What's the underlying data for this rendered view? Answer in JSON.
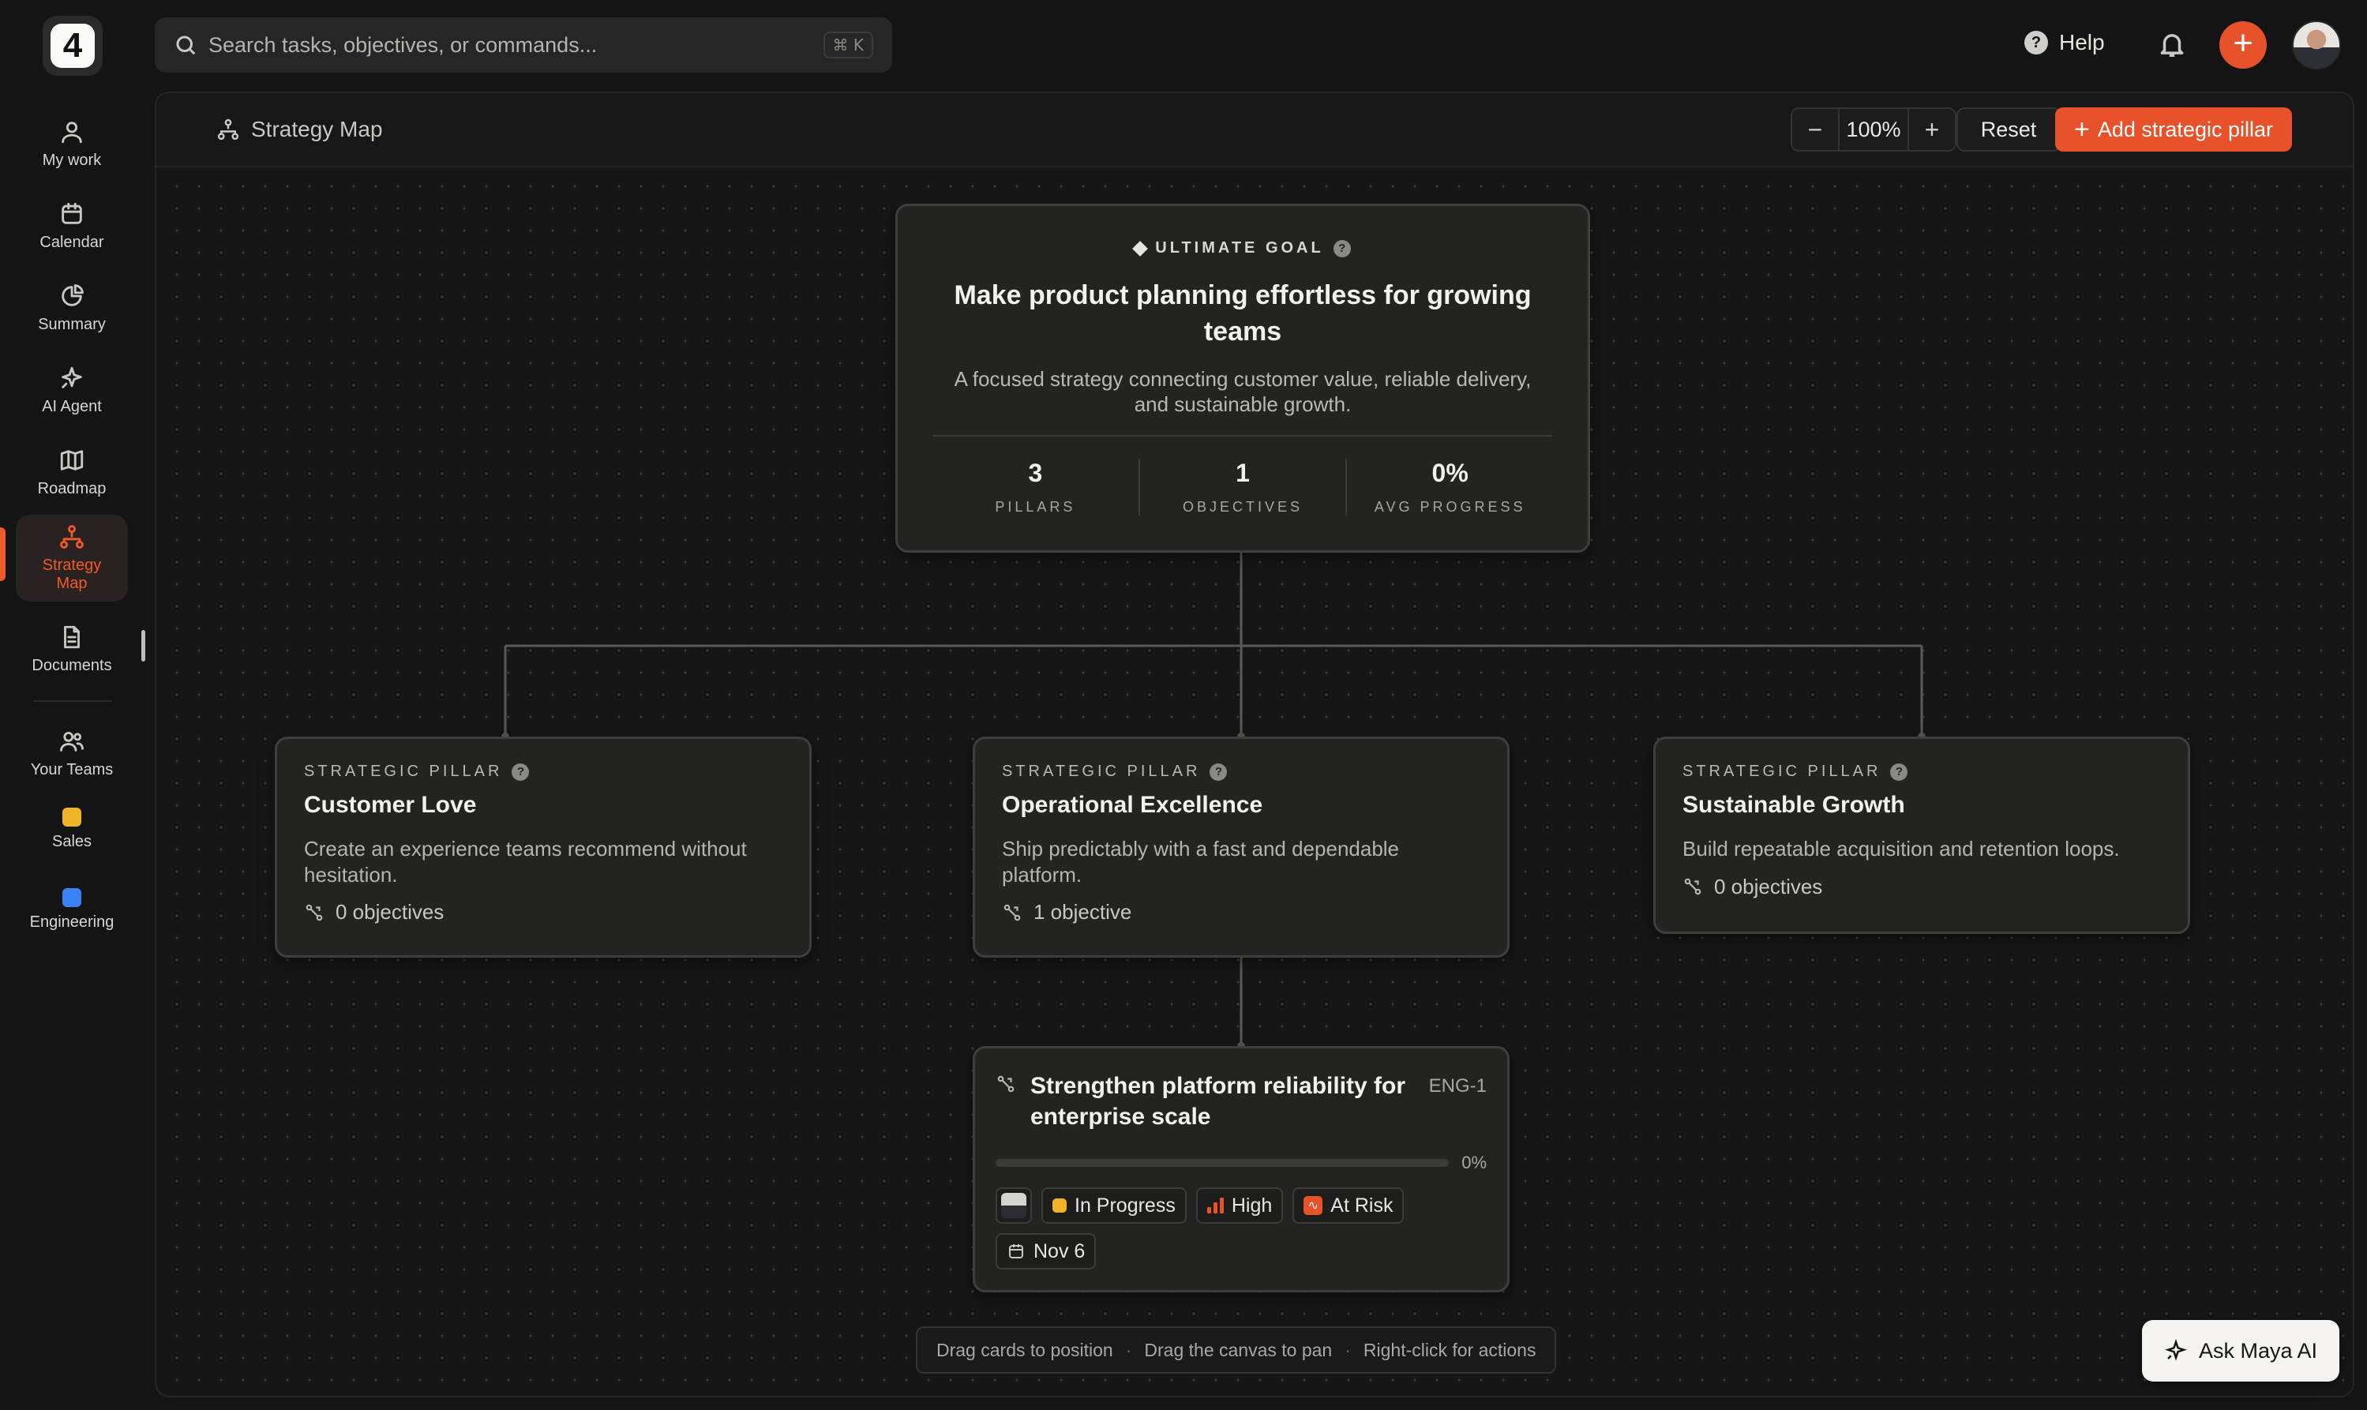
{
  "app": {
    "logo_text": "4"
  },
  "sidebar": {
    "items": [
      {
        "label": "My work",
        "icon": "person-icon"
      },
      {
        "label": "Calendar",
        "icon": "calendar-icon"
      },
      {
        "label": "Summary",
        "icon": "pie-chart-icon"
      },
      {
        "label": "AI Agent",
        "icon": "sparkle-icon"
      },
      {
        "label": "Roadmap",
        "icon": "map-icon"
      },
      {
        "label": "Strategy\nMap",
        "icon": "hierarchy-icon",
        "active": true
      },
      {
        "label": "Documents",
        "icon": "document-icon"
      }
    ],
    "teams_label": "Your Teams",
    "teams": [
      {
        "label": "Sales",
        "color": "#f0b429"
      },
      {
        "label": "Engineering",
        "color": "#3b82f6"
      }
    ]
  },
  "topbar": {
    "search_placeholder": "Search tasks, objectives, or commands...",
    "search_shortcut": "⌘ K",
    "help_label": "Help"
  },
  "header": {
    "breadcrumb": "Strategy Map",
    "zoom_value": "100%",
    "reset_label": "Reset",
    "add_pillar_label": "Add strategic pillar"
  },
  "goal": {
    "tag": "ULTIMATE GOAL",
    "title": "Make product planning effortless for growing teams",
    "description": "A focused strategy connecting customer value, reliable delivery, and sustainable growth.",
    "stats": [
      {
        "value": "3",
        "label": "PILLARS"
      },
      {
        "value": "1",
        "label": "OBJECTIVES"
      },
      {
        "value": "0%",
        "label": "AVG PROGRESS"
      }
    ]
  },
  "pillars": [
    {
      "tag": "STRATEGIC PILLAR",
      "title": "Customer Love",
      "description": "Create an experience teams recommend without hesitation.",
      "count": "0 objectives"
    },
    {
      "tag": "STRATEGIC PILLAR",
      "title": "Operational Excellence",
      "description": "Ship predictably with a fast and dependable platform.",
      "count": "1 objective"
    },
    {
      "tag": "STRATEGIC PILLAR",
      "title": "Sustainable Growth",
      "description": "Build repeatable acquisition and retention loops.",
      "count": "0 objectives"
    }
  ],
  "objective": {
    "title": "Strengthen platform reliability for enterprise scale",
    "id": "ENG-1",
    "progress": 0,
    "progress_label": "0%",
    "status": "In Progress",
    "priority": "High",
    "health": "At Risk",
    "due": "Nov 6"
  },
  "hint": {
    "a": "Drag cards to position",
    "b": "Drag the canvas to pan",
    "c": "Right-click for actions",
    "sep": "·"
  },
  "ask_ai_label": "Ask Maya AI",
  "colors": {
    "accent": "#e8522a",
    "background": "#141414",
    "card": "#232322"
  }
}
